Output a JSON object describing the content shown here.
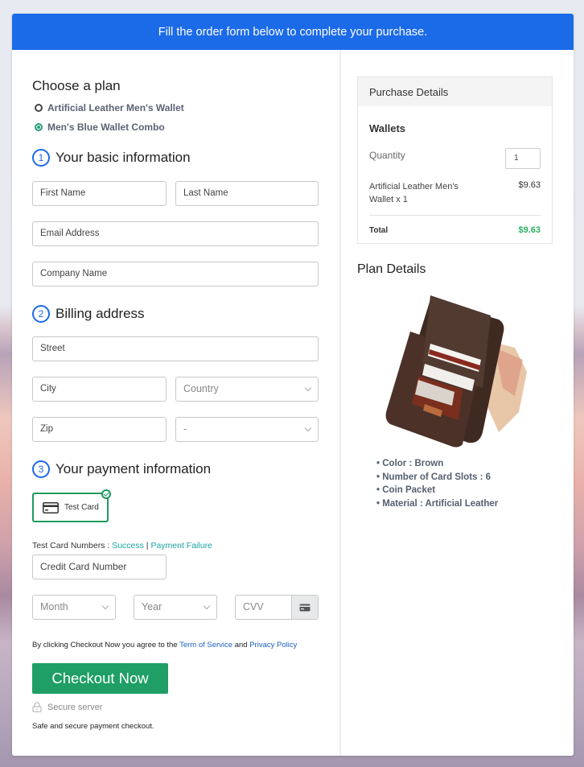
{
  "banner": {
    "text": "Fill the order form below to complete your purchase."
  },
  "plan": {
    "heading": "Choose a plan",
    "options": [
      {
        "label": "Artificial Leather Men's Wallet",
        "selected": false
      },
      {
        "label": "Men's Blue Wallet Combo",
        "selected": true
      }
    ]
  },
  "basic_info": {
    "number": "1",
    "heading": "Your basic information",
    "first_name_placeholder": "First Name",
    "last_name_placeholder": "Last Name",
    "email_placeholder": "Email Address",
    "company_placeholder": "Company Name"
  },
  "billing": {
    "number": "2",
    "heading": "Billing address",
    "street_placeholder": "Street",
    "city_placeholder": "City",
    "country_value": "Country",
    "zip_placeholder": "Zip",
    "state_value": "-"
  },
  "payment": {
    "number": "3",
    "heading": "Your payment information",
    "method_label": "Test Card",
    "test_numbers_label": "Test Card Numbers : ",
    "success_link": "Success",
    "separator": " | ",
    "failure_link": "Payment Failure",
    "card_number_placeholder": "Credit Card Number",
    "month_value": "Month",
    "year_value": "Year",
    "cvv_placeholder": "CVV"
  },
  "agreement": {
    "prefix": "By clicking Checkout Now you agree to the ",
    "terms_link": "Term of Service",
    "and": " and ",
    "privacy_link": "Privacy Policy"
  },
  "checkout_button": "Checkout Now",
  "secure_label": "Secure server",
  "safe_text": "Safe and secure payment checkout.",
  "purchase": {
    "heading": "Purchase Details",
    "product_title": "Wallets",
    "quantity_label": "Quantity",
    "quantity_value": "1",
    "item_name": "Artificial Leather Men's Wallet x 1",
    "item_price": "$9.63",
    "total_label": "Total",
    "total_value": "$9.63"
  },
  "plan_details": {
    "heading": "Plan Details",
    "image_alt": "Brown leather wallet",
    "features": [
      "Color : Brown",
      "Number of Card Slots : 6",
      "Coin Packet",
      "Material : Artificial Leather"
    ]
  },
  "colors": {
    "primary": "#1b6ae8",
    "checkout": "#1f9e66",
    "total": "#2bb060",
    "selected_radio": "#2a9d7d"
  }
}
